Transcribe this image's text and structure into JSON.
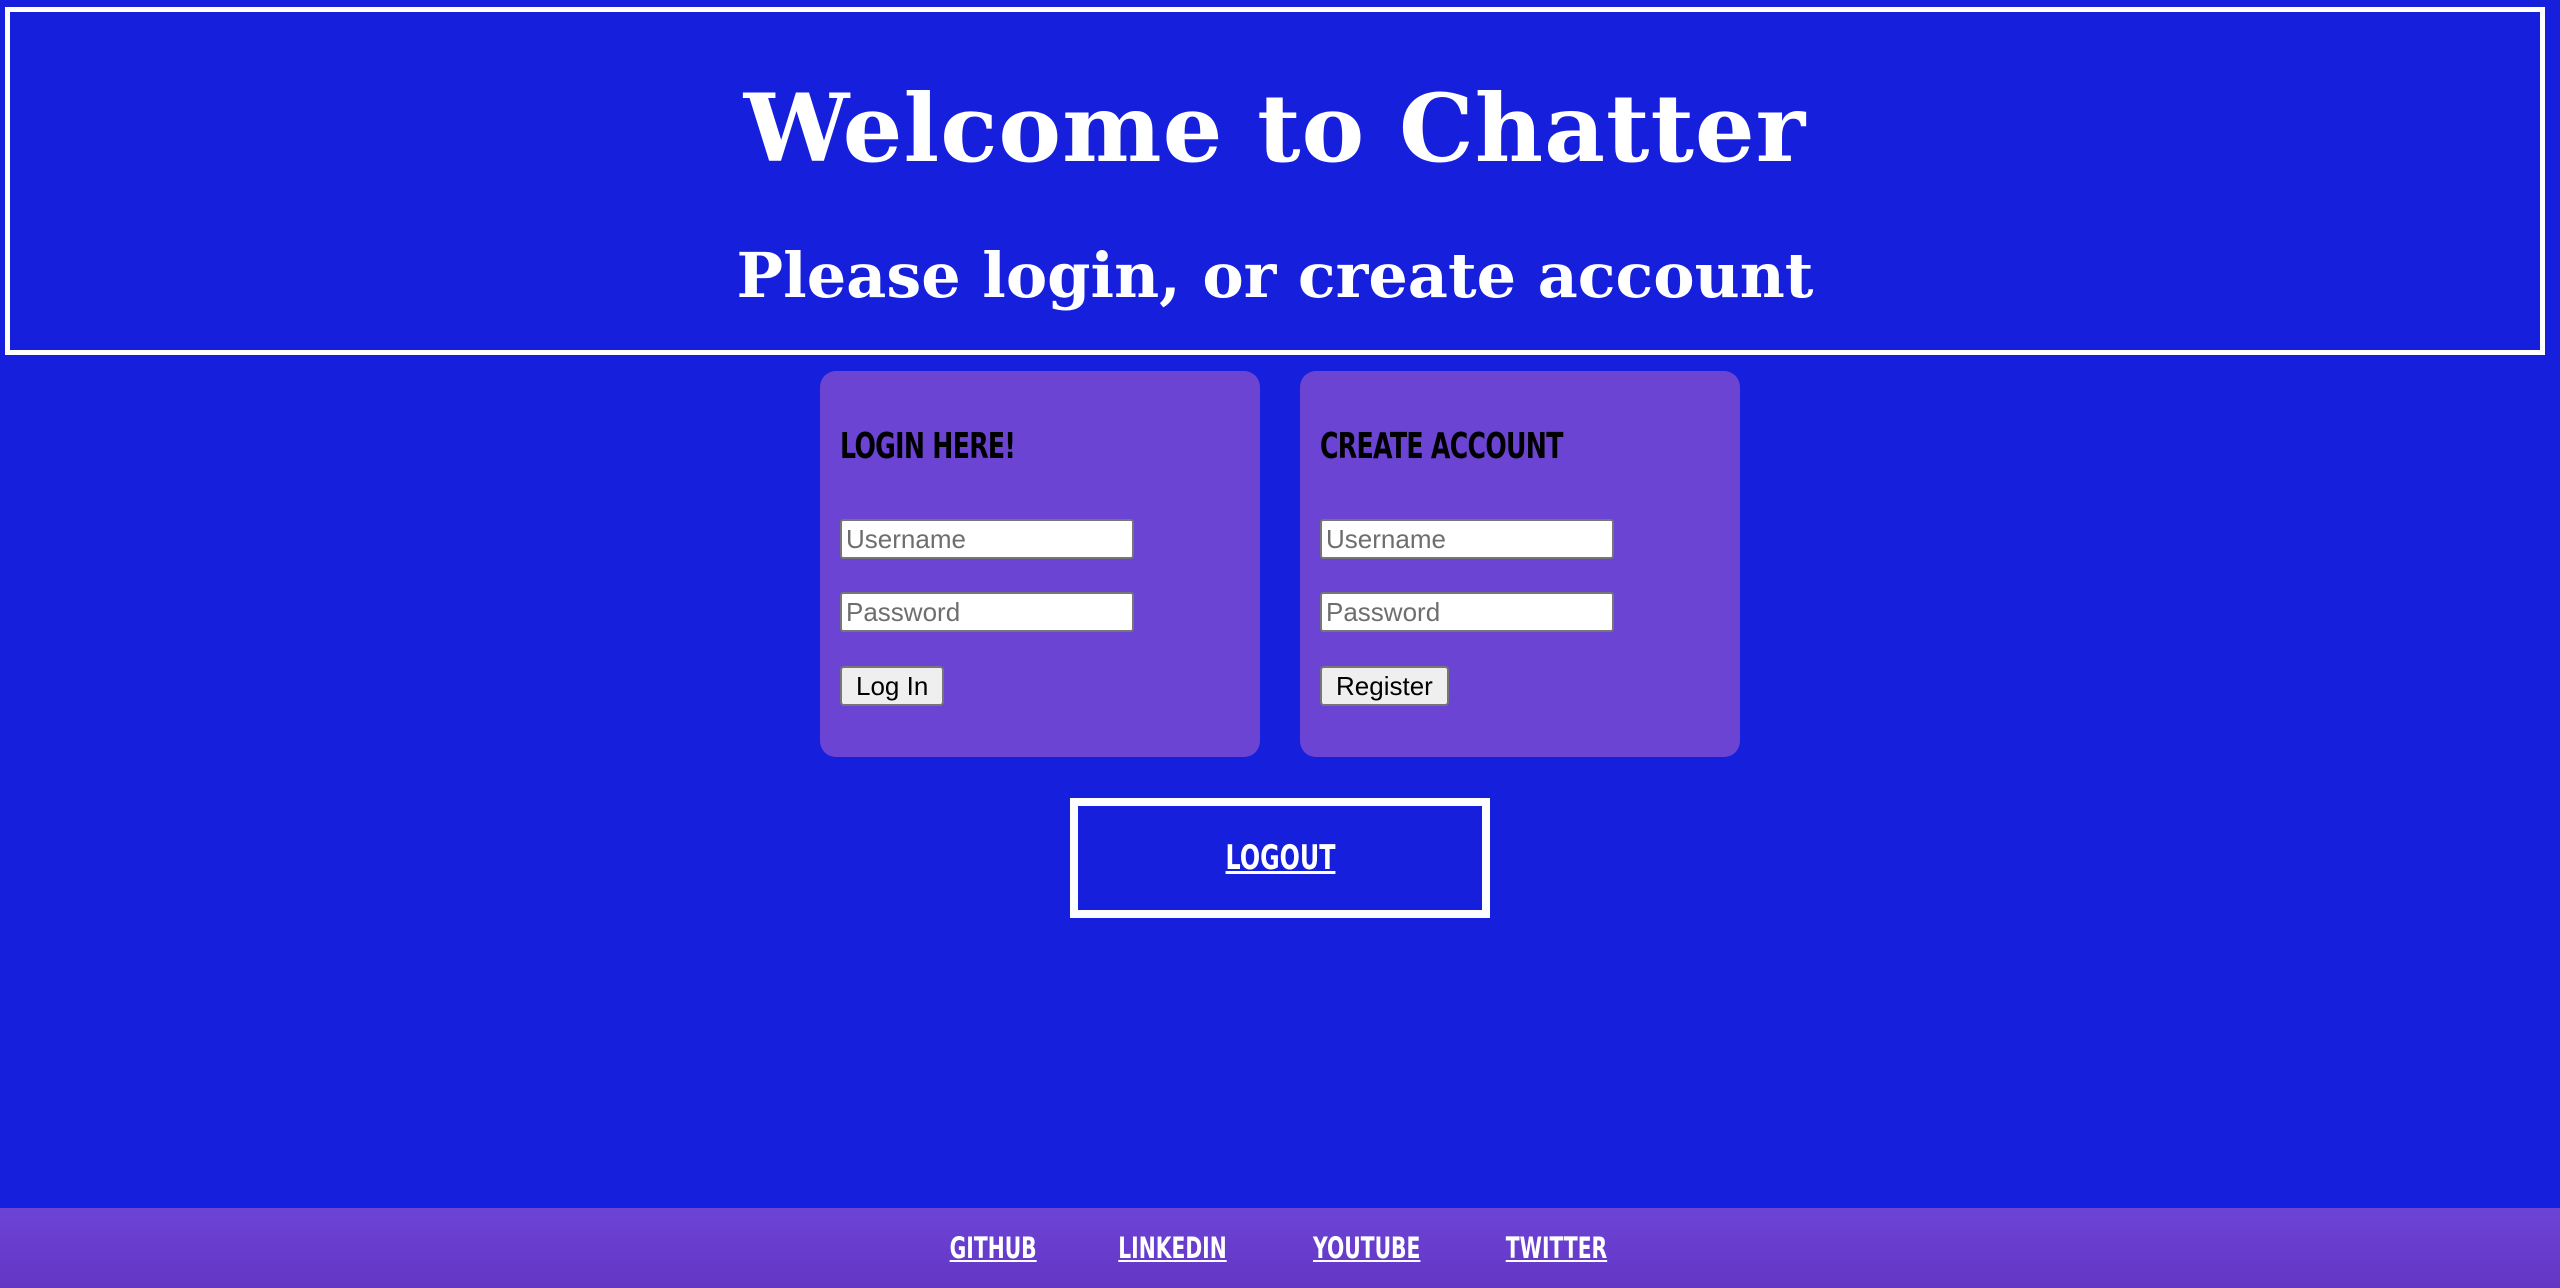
{
  "header": {
    "title": "Welcome to Chatter",
    "subtitle": "Please login, or create account"
  },
  "login": {
    "heading": "LOGIN HERE!",
    "username_placeholder": "Username",
    "password_placeholder": "Password",
    "button_label": "Log In"
  },
  "register": {
    "heading": "CREATE ACCOUNT",
    "username_placeholder": "Username",
    "password_placeholder": "Password",
    "button_label": "Register"
  },
  "logout": {
    "label": "LOGOUT"
  },
  "footer": {
    "links": [
      {
        "label": "GITHUB"
      },
      {
        "label": "LINKEDIN"
      },
      {
        "label": "YOUTUBE"
      },
      {
        "label": "TWITTER"
      }
    ]
  },
  "colors": {
    "background": "#1620dc",
    "panel": "#6b44d4",
    "footer": "#6c44d6",
    "text": "#ffffff"
  }
}
